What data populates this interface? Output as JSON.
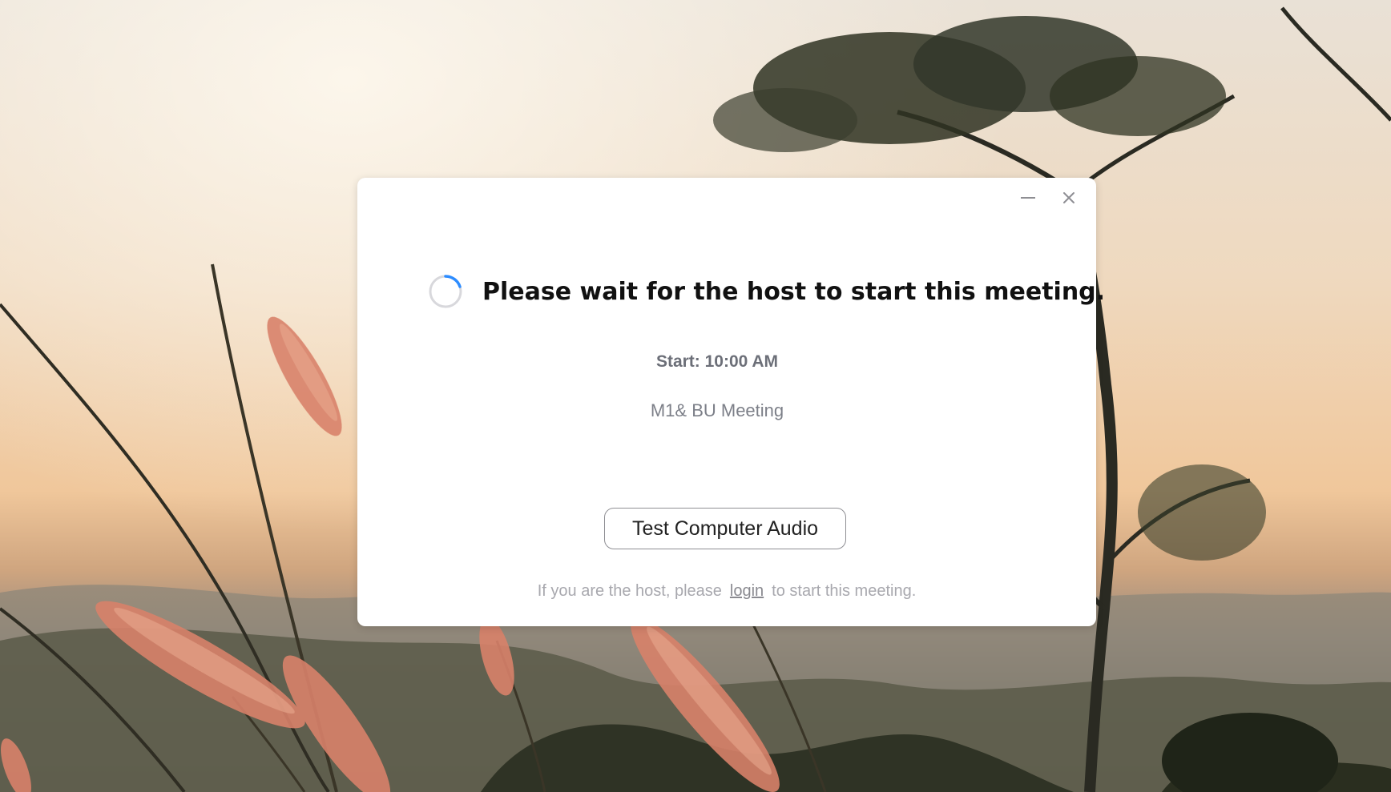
{
  "background": {
    "description_icon": "landscape-wallpaper"
  },
  "window": {
    "minimize_icon": "minimize-icon",
    "close_icon": "close-icon"
  },
  "waiting": {
    "spinner_icon": "loading-spinner-icon",
    "heading": "Please wait for the host to start this meeting.",
    "start_time": "Start: 10:00 AM",
    "meeting_name": "M1& BU Meeting",
    "audio_button_label": "Test Computer Audio",
    "host_note_before": "If you are the host, please",
    "host_note_link": "login",
    "host_note_after": "to start this meeting."
  },
  "colors": {
    "spinner_accent": "#2d8cff",
    "spinner_track": "#d8d8dc",
    "heading": "#111111",
    "secondary_text": "#7c7f88"
  }
}
